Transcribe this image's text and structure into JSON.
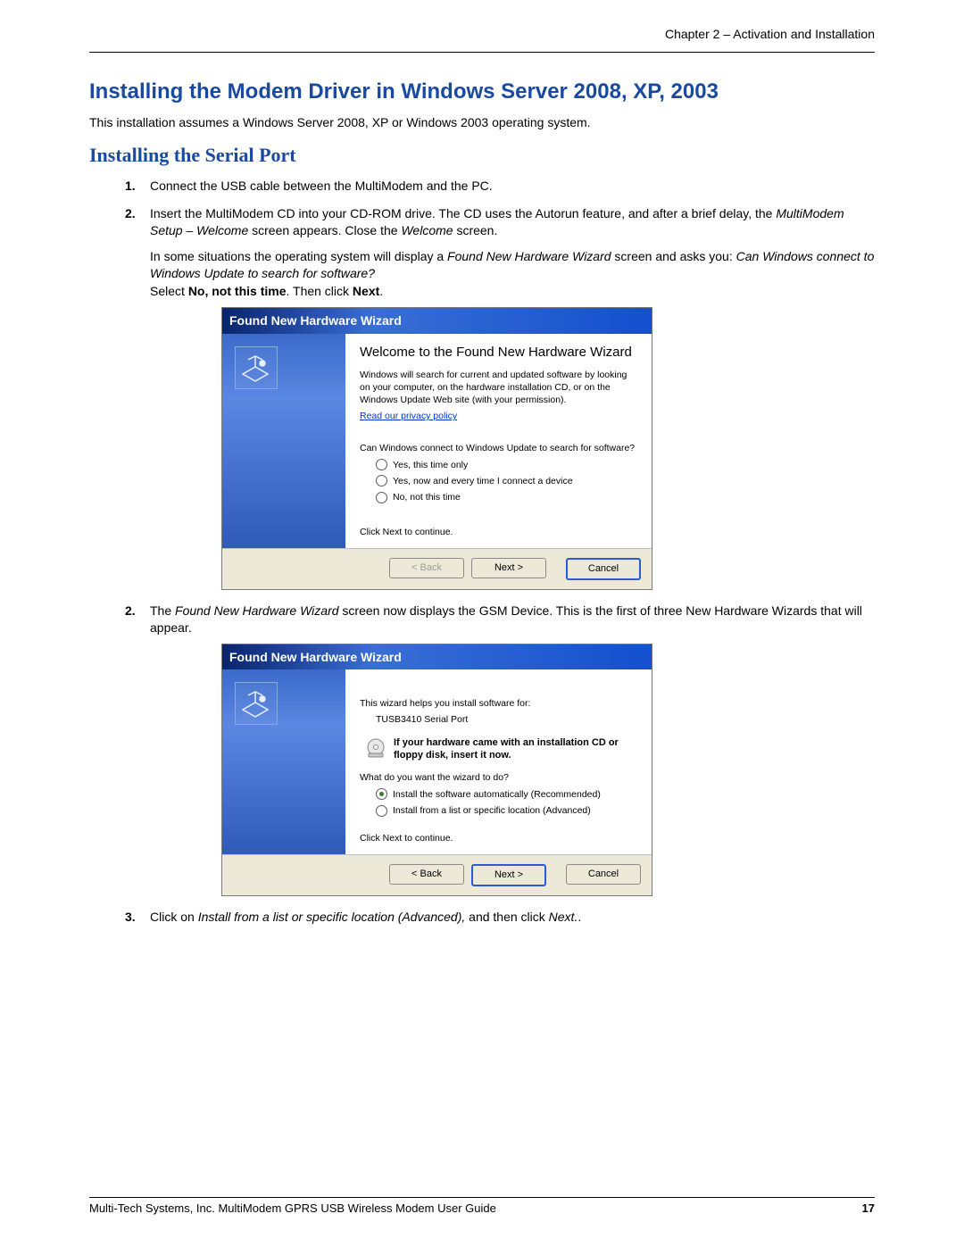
{
  "header": {
    "chapter_line": "Chapter 2 – Activation and Installation"
  },
  "main_heading": "Installing the Modem Driver in Windows Server 2008,  XP, 2003",
  "intro": "This installation assumes a Windows Server 2008,  XP or Windows 2003 operating system.",
  "sub_heading": "Installing the Serial Port",
  "step1": {
    "num": "1.",
    "text": "Connect the USB cable between the MultiModem and the PC."
  },
  "step2": {
    "num": "2.",
    "p1_a": "Insert the MultiModem CD into your CD-ROM drive. The CD uses the Autorun feature, and after a brief delay, the ",
    "p1_i1": "MultiModem Setup – Welcome",
    "p1_b": " screen appears. Close the ",
    "p1_i2": "Welcome",
    "p1_c": " screen.",
    "p2_a": "In some situations the operating system will display a ",
    "p2_i1": "Found New Hardware Wizard",
    "p2_b": " screen and asks you: ",
    "p2_i2": "Can Windows connect to Windows Update to search for software?",
    "p3_a": "Select ",
    "p3_b1": "No, not this time",
    "p3_b": ".  Then click ",
    "p3_b2": "Next",
    "p3_c": "."
  },
  "wizard1": {
    "title": "Found New Hardware Wizard",
    "heading": "Welcome to the Found New Hardware Wizard",
    "desc": "Windows will search for current and updated software by looking on your computer, on the hardware installation CD, or on the Windows Update Web site (with your permission).",
    "privacy_link": "Read our privacy policy",
    "question": "Can Windows connect to Windows Update to search for software?",
    "opt1": "Yes, this time only",
    "opt2": "Yes, now and every time I connect a device",
    "opt3": "No, not this time",
    "continue": "Click Next to continue.",
    "btn_back": "< Back",
    "btn_next": "Next >",
    "btn_cancel": "Cancel"
  },
  "step2b": {
    "num": "2.",
    "a": "The ",
    "i1": "Found New Hardware Wizard",
    "b": " screen now displays the GSM Device. This is the first of three New Hardware Wizards that will appear."
  },
  "wizard2": {
    "title": "Found New Hardware Wizard",
    "line1": "This wizard helps you install software for:",
    "device": "TUSB3410 Serial Port",
    "cd_hint": "If your hardware came with an installation CD or floppy disk, insert it now.",
    "question": "What do you want the wizard to do?",
    "opt1": "Install the software automatically (Recommended)",
    "opt2": "Install from a list or specific location (Advanced)",
    "continue": "Click Next to continue.",
    "btn_back": "< Back",
    "btn_next": "Next >",
    "btn_cancel": "Cancel"
  },
  "step3": {
    "num": "3.",
    "a": "Click on ",
    "i1": "Install from a list or specific location (Advanced),",
    "b": " and then click ",
    "i2": "Next.",
    "c": "."
  },
  "footer": {
    "left": "Multi-Tech Systems, Inc. MultiModem GPRS USB Wireless Modem User Guide",
    "right": "17"
  }
}
